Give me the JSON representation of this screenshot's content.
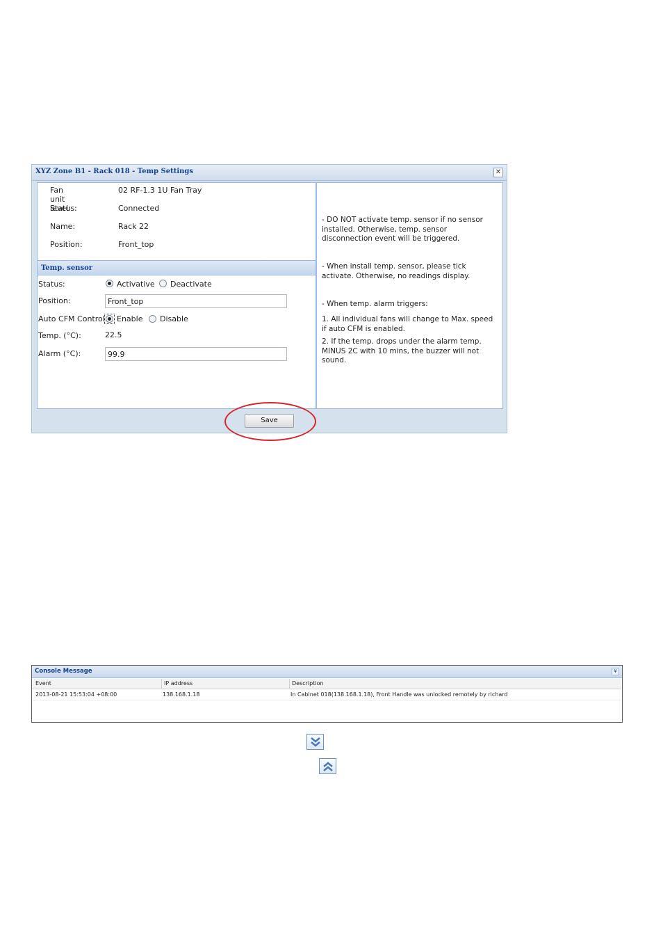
{
  "dialog": {
    "title": "XYZ Zone B1 - Rack 018 - Temp Settings",
    "close_glyph": "✕",
    "info": [
      {
        "label": "Fan unit level:",
        "value": "02 RF-1.3 1U Fan Tray"
      },
      {
        "label": "Status:",
        "value": "Connected"
      },
      {
        "label": "Name:",
        "value": "Rack 22"
      },
      {
        "label": "Position:",
        "value": "Front_top"
      }
    ],
    "sensor": {
      "section_title": "Temp. sensor",
      "status_label": "Status:",
      "status_options": [
        "Activative",
        "Deactivate"
      ],
      "status_selected": "Activative",
      "position_label": "Position:",
      "position_value": "Front_top",
      "cfm_label": "Auto CFM Control:",
      "cfm_options": [
        "Enable",
        "Disable"
      ],
      "cfm_selected": "Enable",
      "temp_label": "Temp. (°C):",
      "temp_value": "22.5",
      "alarm_label": "Alarm (°C):",
      "alarm_value": "99.9"
    },
    "notes": [
      "- DO NOT activate temp. sensor if no sensor installed. Otherwise, temp. sensor disconnection event will be triggered.",
      "- When install temp. sensor, please tick activate. Otherwise, no readings display.",
      "- When temp. alarm triggers:",
      "1. All individual fans will change to Max. speed if auto CFM is enabled.",
      "2. If the temp. drops under the alarm temp. MINUS 2C with 10 mins, the buzzer will not sound."
    ],
    "save_label": "Save",
    "highlight_color": "#d8232a"
  },
  "console": {
    "title": "Console Message",
    "columns": [
      "Event",
      "IP address",
      "Description"
    ],
    "rows": [
      {
        "event": "2013-08-21 15:53:04 +08:00",
        "ip": "138.168.1.18",
        "description": "In Cabinet 018(138.168.1.18), Front Handle was unlocked remotely by richard"
      }
    ]
  },
  "icons": {
    "expand": "double-chevron-down-icon",
    "collapse": "double-chevron-up-icon",
    "accent": "#15428b"
  }
}
